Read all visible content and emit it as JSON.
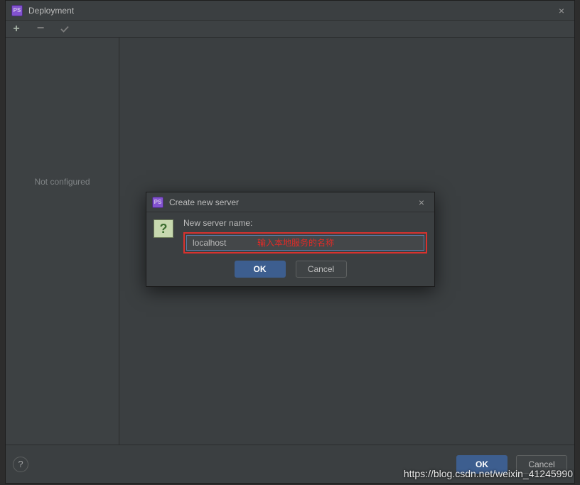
{
  "parent": {
    "title": "Deployment",
    "close_icon": "×",
    "toolbar": {
      "add_icon": "+",
      "remove_icon": "−",
      "apply_icon": "✓"
    },
    "sidebar": {
      "not_configured_label": "Not configured"
    },
    "footer": {
      "help_icon": "?",
      "ok_label": "OK",
      "cancel_label": "Cancel"
    }
  },
  "modal": {
    "title": "Create new server",
    "close_icon": "×",
    "question_icon": "?",
    "field_label": "New server name:",
    "input_value": "localhost",
    "annotation": "输入本地服务的名称",
    "ok_label": "OK",
    "cancel_label": "Cancel"
  },
  "watermark": "https://blog.csdn.net/weixin_41245990"
}
